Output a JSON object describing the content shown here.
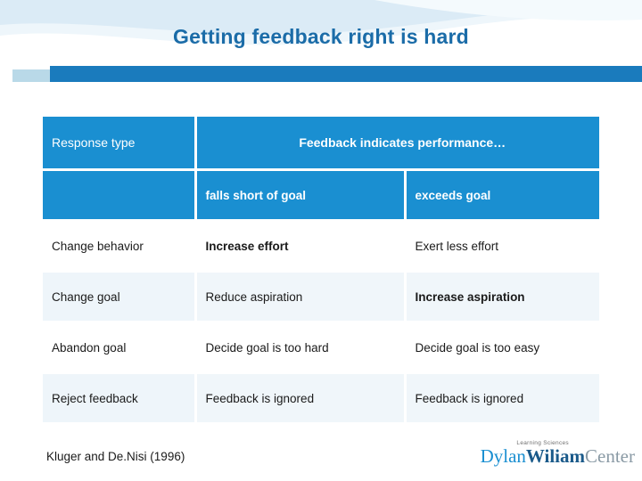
{
  "slide": {
    "title": "Getting feedback right is hard",
    "citation": "Kluger and De.Nisi (1996)"
  },
  "table": {
    "header": {
      "response_type": "Response type",
      "performance": "Feedback indicates performance…"
    },
    "subheader": {
      "blank": "",
      "below": "falls short of goal",
      "above": "exceeds goal"
    },
    "rows": [
      {
        "response": "Change behavior",
        "below": "Increase effort",
        "below_bold": true,
        "above": "Exert less effort",
        "above_bold": false
      },
      {
        "response": "Change goal",
        "below": "Reduce aspiration",
        "below_bold": false,
        "above": "Increase aspiration",
        "above_bold": true
      },
      {
        "response": "Abandon goal",
        "below": "Decide goal is too hard",
        "below_bold": false,
        "above": "Decide goal is too easy",
        "above_bold": false
      },
      {
        "response": "Reject feedback",
        "below": "Feedback is ignored",
        "below_bold": false,
        "above": "Feedback is ignored",
        "above_bold": false
      }
    ]
  },
  "logo": {
    "tagline": "Learning Sciences",
    "name_first": "Dylan",
    "name_last": "Wiliam",
    "name_suffix": "Center"
  },
  "colors": {
    "title": "#1b6ca8",
    "table_header": "#1a8fd1",
    "bar": "#1a7bbd",
    "bar_light": "#b9d9e8"
  }
}
